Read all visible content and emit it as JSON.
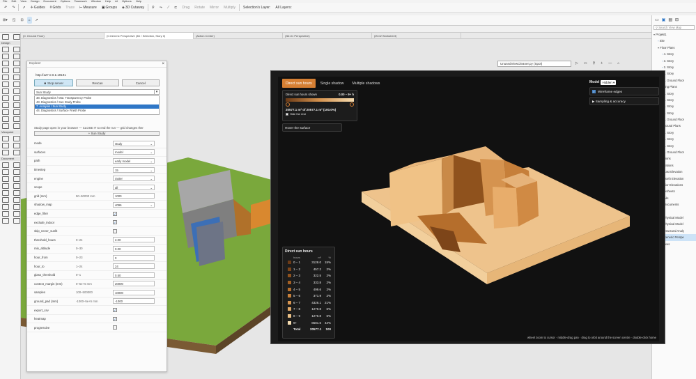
{
  "menubar": {
    "items": [
      "File",
      "Edit",
      "View",
      "Design",
      "Document",
      "Options",
      "Teamwork",
      "Window",
      "Help",
      "AI",
      "Options",
      "Help"
    ]
  },
  "toolbar1": {
    "guides": "Guides",
    "grids": "Grids",
    "trace": "Trace",
    "measure": "Measure",
    "groups": "Groups",
    "cutaway": "3D Cutaway",
    "drag": "Drag",
    "rotate": "Rotate",
    "mirror": "Mirror",
    "multiply": "Multiply",
    "selections_layer": "Selection's Layer:",
    "all_layers": "All Layers:"
  },
  "tabs": [
    "(0. Ground Floor)",
    "(0.Generic Perspective (3D / Selection, Story 0)",
    "(Action Center)",
    "(3D-01 Perspective)",
    "(W-02 Worksheet)"
  ],
  "toolbox": {
    "design": "Design",
    "viewpoint": "Viewpoint",
    "document": "Document"
  },
  "view_ctrl": {
    "script": "UnusedViewCleaner.py (Spot)"
  },
  "navigator": {
    "search_placeholder": "Search View Map",
    "items": [
      {
        "label": "Projekt1",
        "type": "fold",
        "indent": 0
      },
      {
        "label": "Site",
        "type": "sub",
        "indent": 1
      },
      {
        "label": "Floor Plans",
        "type": "fold",
        "indent": 1
      },
      {
        "label": "4. Story",
        "type": "sub",
        "indent": 2
      },
      {
        "label": "3. Story",
        "type": "sub",
        "indent": 2
      },
      {
        "label": "2. Story",
        "type": "sub",
        "indent": 2
      },
      {
        "label": "1. Story",
        "type": "sub",
        "indent": 2
      },
      {
        "label": "0. Ground Floor",
        "type": "sub",
        "indent": 2
      },
      {
        "label": "Ceiling Plans",
        "type": "fold",
        "indent": 1
      },
      {
        "label": "4. Story",
        "type": "sub",
        "indent": 2
      },
      {
        "label": "3. Story",
        "type": "sub",
        "indent": 2
      },
      {
        "label": "2. Story",
        "type": "sub",
        "indent": 2
      },
      {
        "label": "1. Story",
        "type": "sub",
        "indent": 2
      },
      {
        "label": "0. Ground Floor",
        "type": "sub",
        "indent": 2
      },
      {
        "label": "Structural Plans",
        "type": "fold",
        "indent": 1
      },
      {
        "label": "4. Story",
        "type": "sub",
        "indent": 2
      },
      {
        "label": "3. Story",
        "type": "sub",
        "indent": 2
      },
      {
        "label": "1. Story",
        "type": "sub",
        "indent": 2
      },
      {
        "label": "0. Ground Floor",
        "type": "sub",
        "indent": 2
      },
      {
        "label": "Sections",
        "type": "sub",
        "indent": 1
      },
      {
        "label": "Elevations",
        "type": "fold",
        "indent": 1
      },
      {
        "label": "East Elevation",
        "type": "sub",
        "indent": 2
      },
      {
        "label": "North Elevation",
        "type": "sub",
        "indent": 2
      },
      {
        "label": "Interior Elevations",
        "type": "sub",
        "indent": 1
      },
      {
        "label": "Worksheets",
        "type": "sub",
        "indent": 1
      },
      {
        "label": "Details",
        "type": "sub",
        "indent": 1
      },
      {
        "label": "3D Documents",
        "type": "sub",
        "indent": 1
      },
      {
        "label": "3D",
        "type": "fold",
        "indent": 1
      },
      {
        "label": "Physical Model",
        "type": "sub",
        "indent": 2
      },
      {
        "label": "Physical Model",
        "type": "sub",
        "indent": 2
      },
      {
        "label": "Structural Analy",
        "type": "sub",
        "indent": 2
      },
      {
        "label": "Generic Perspe",
        "type": "sel",
        "indent": 2
      },
      {
        "label": "Indexes",
        "type": "sub",
        "indent": 1
      }
    ]
  },
  "explorer": {
    "title": "Explorer",
    "url": "http://127.0.0.1:19191",
    "stop_label": "Stop server",
    "rescan_label": "Rescan",
    "cancel_label": "Cancel",
    "study_select": "Sun Study",
    "list": [
      "38. Diagnostics / Mat. Transparency Probe",
      "43. Diagnostics / Sun Study Probe",
      "7. Analysis / Sun Study",
      "44. Diagnostics / Surface Finish Probe"
    ],
    "selected_index": 2,
    "notice": "Study page open in your browser — CLOSE IT to end the run — grid changes ther",
    "study_button": "+ Sun Study",
    "fields": [
      {
        "label": "mode",
        "range": "",
        "value": "study",
        "kind": "select"
      },
      {
        "label": "surfaces",
        "range": "",
        "value": "model",
        "kind": "select"
      },
      {
        "label": "path",
        "range": "",
        "value": "early model",
        "kind": "select"
      },
      {
        "label": "timestep",
        "range": "",
        "value": "15",
        "kind": "select"
      },
      {
        "label": "engine",
        "range": "",
        "value": "raster",
        "kind": "select"
      },
      {
        "label": "scope",
        "range": "",
        "value": "all",
        "kind": "select"
      },
      {
        "label": "grid (mm)",
        "range": "50–50000 mm",
        "value": "1000",
        "kind": "text"
      },
      {
        "label": "shadow_map",
        "range": "",
        "value": "4096",
        "kind": "select"
      },
      {
        "label": "edge_filter",
        "range": "",
        "value": true,
        "kind": "check"
      },
      {
        "label": "exclude_indoor",
        "range": "",
        "value": true,
        "kind": "check"
      },
      {
        "label": "skip_never_sunlit",
        "range": "",
        "value": false,
        "kind": "check"
      },
      {
        "label": "threshold_hours",
        "range": "0–24",
        "value": "2.00",
        "kind": "text"
      },
      {
        "label": "min_altitude",
        "range": "0–30",
        "value": "0.00",
        "kind": "text"
      },
      {
        "label": "hour_from",
        "range": "0–23",
        "value": "0",
        "kind": "text"
      },
      {
        "label": "hour_to",
        "range": "1–24",
        "value": "24",
        "kind": "text"
      },
      {
        "label": "glass_threshold",
        "range": "0–1",
        "value": "0.50",
        "kind": "text"
      },
      {
        "label": "context_margin (mm)",
        "range": "0–5e+5 mm",
        "value": "20000",
        "kind": "text"
      },
      {
        "label": "samples",
        "range": "100–500000",
        "value": "10000",
        "kind": "text"
      },
      {
        "label": "ground_pad (mm)",
        "range": "-1000–5e+5 mm",
        "value": "-1000",
        "kind": "text"
      },
      {
        "label": "export_csv",
        "range": "",
        "value": true,
        "kind": "check"
      },
      {
        "label": "heatmap",
        "range": "",
        "value": true,
        "kind": "check"
      },
      {
        "label": "progressive",
        "range": "",
        "value": false,
        "kind": "check"
      }
    ]
  },
  "study": {
    "tabs": [
      "Direct sun hours",
      "Single shadow",
      "Multiple shadows"
    ],
    "active_tab": 0,
    "range_title": "Direct sun hours shown",
    "range_value": "0.00 – 9+ h",
    "area_text": "20577.1 m² of 20577.1 m² (100.0%)",
    "hide_rest": "Hide the rest",
    "hover": "Hover the surface",
    "model_label": "Model",
    "model_value": "Hidden",
    "wireframe": "Wireframe edges",
    "sampling": "▶ Sampling & accuracy",
    "footer": "wheel zoom to cursor · middle-drag pan · drag to orbit around the screen centre · double-click home",
    "legend": {
      "title": "Direct sun hours",
      "headers": [
        "hours",
        "m²",
        "%"
      ],
      "rows": [
        {
          "h": "0 – 1",
          "m2": "3128.0",
          "p": "15%",
          "c": "#6b3a16"
        },
        {
          "h": "1 – 2",
          "m2": "457.2",
          "p": "2%",
          "c": "#7d4519"
        },
        {
          "h": "2 – 3",
          "m2": "322.5",
          "p": "2%",
          "c": "#8f521d"
        },
        {
          "h": "3 – 4",
          "m2": "333.8",
          "p": "2%",
          "c": "#a25f23"
        },
        {
          "h": "4 – 5",
          "m2": "499.6",
          "p": "2%",
          "c": "#b56e2c"
        },
        {
          "h": "5 – 6",
          "m2": "371.9",
          "p": "2%",
          "c": "#c67f3a"
        },
        {
          "h": "6 – 7",
          "m2": "4326.1",
          "p": "21%",
          "c": "#d5934f"
        },
        {
          "h": "7 – 8",
          "m2": "1279.8",
          "p": "6%",
          "c": "#e1a967"
        },
        {
          "h": "8 – 9",
          "m2": "1276.8",
          "p": "6%",
          "c": "#ecc186"
        },
        {
          "h": "9+",
          "m2": "8581.6",
          "p": "42%",
          "c": "#f6dcb0"
        }
      ],
      "total_label": "Total",
      "total_m2": "20577.1",
      "total_p": "100"
    }
  }
}
